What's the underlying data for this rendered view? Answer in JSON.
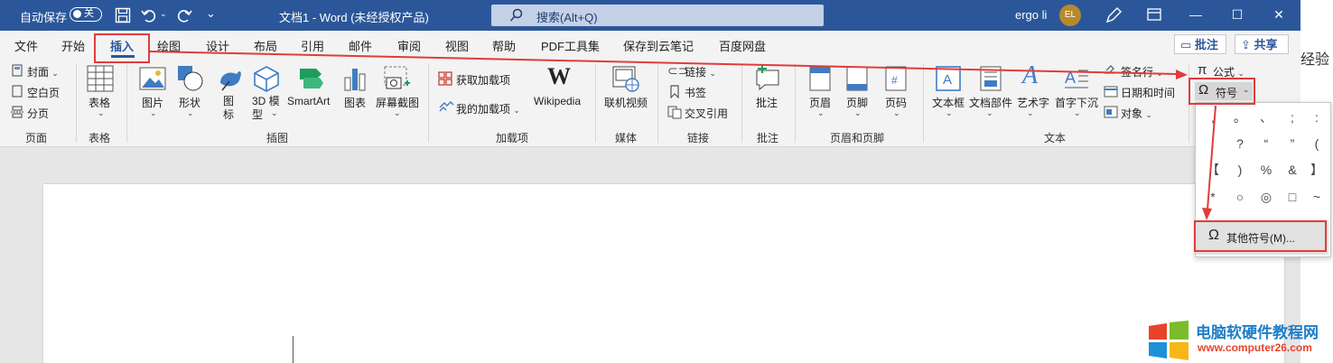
{
  "titlebar": {
    "autosave_label": "自动保存",
    "autosave_state": "关",
    "doc_title": "文档1  -  Word (未经授权产品)",
    "search_placeholder": "搜索(Alt+Q)",
    "user_name": "ergo li",
    "avatar_initials": "EL"
  },
  "tabs": [
    "文件",
    "开始",
    "插入",
    "绘图",
    "设计",
    "布局",
    "引用",
    "邮件",
    "审阅",
    "视图",
    "帮助",
    "PDF工具集",
    "保存到云笔记",
    "百度网盘"
  ],
  "active_tab": "插入",
  "top_right": {
    "comments": "批注",
    "share": "共享"
  },
  "ribbon": {
    "pages": {
      "group": "页面",
      "cover": "封面",
      "blank": "空白页",
      "break": "分页"
    },
    "tables": {
      "group": "表格",
      "table": "表格"
    },
    "illustrations": {
      "group": "插图",
      "picture": "图片",
      "shapes": "形状",
      "icons": "图\n标",
      "model3d": "3D 模\n型",
      "smartart": "SmartArt",
      "chart": "图表",
      "screenshot": "屏幕截图"
    },
    "addins": {
      "group": "加载项",
      "get": "获取加载项",
      "mine": "我的加载项",
      "wikipedia": "Wikipedia"
    },
    "media": {
      "group": "媒体",
      "video": "联机视频"
    },
    "links": {
      "group": "链接",
      "link": "链接",
      "bookmark": "书签",
      "crossref": "交叉引用"
    },
    "comments": {
      "group": "批注",
      "comment": "批注"
    },
    "header_footer": {
      "group": "页眉和页脚",
      "header": "页眉",
      "footer": "页脚",
      "page_number": "页码"
    },
    "text": {
      "group": "文本",
      "textbox": "文本框",
      "quickparts": "文档部件",
      "wordart": "艺术字",
      "dropcap": "首字下沉",
      "signature": "签名行",
      "datetime": "日期和时间",
      "object": "对象"
    },
    "symbols": {
      "equation": "公式",
      "symbol": "符号"
    }
  },
  "symbol_dropdown": {
    "symbols": [
      ",",
      "。",
      "、",
      ";",
      ":",
      "!",
      "?",
      "“",
      "”",
      "(",
      "【",
      ")",
      "%",
      "&",
      "】",
      "*",
      "○",
      "◎",
      "□",
      "~"
    ],
    "more_label": "其他符号(M)..."
  },
  "side_text": "经验",
  "watermark": {
    "title": "电脑软硬件教程网",
    "url": "www.computer26.com"
  },
  "colors": {
    "word_blue": "#2b579a",
    "annotation_red": "#e03c3c"
  }
}
